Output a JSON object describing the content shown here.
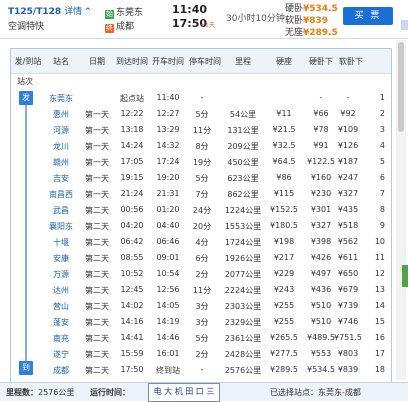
{
  "header": {
    "train_no": "T125/T128",
    "detail_label": "详情",
    "train_type": "空调特快",
    "from_tag": "始",
    "from_station": "东莞东",
    "to_tag": "终",
    "to_station": "成都",
    "depart_time": "11:40",
    "arrive_time": "17:50",
    "next_day": "+1天",
    "duration": "30小时10分钟",
    "prices": [
      {
        "label": "硬卧",
        "value": "¥534.5"
      },
      {
        "label": "软卧",
        "value": "¥839"
      },
      {
        "label": "无座",
        "value": "¥289.5"
      }
    ],
    "buy_label": "买 票"
  },
  "table": {
    "headers": [
      "发/到站",
      "站名",
      "日期",
      "到达时间",
      "开车时间",
      "停车时间",
      "里程",
      "硬座",
      "硬卧下",
      "软卧下"
    ],
    "subheader": "站次",
    "side_start": "发",
    "side_end": "到",
    "rows": [
      {
        "station": "东莞东",
        "day": "",
        "arr": "起点站",
        "dep": "11:40",
        "stop": "-",
        "dist": "",
        "hard": "",
        "hsl": "-",
        "ssl": "-",
        "idx": "1"
      },
      {
        "station": "惠州",
        "day": "第一天",
        "arr": "12:22",
        "dep": "12:27",
        "stop": "5分",
        "dist": "54公里",
        "hard": "¥11",
        "hsl": "¥66",
        "ssl": "¥92",
        "idx": "2"
      },
      {
        "station": "河源",
        "day": "第一天",
        "arr": "13:18",
        "dep": "13:29",
        "stop": "11分",
        "dist": "131公里",
        "hard": "¥21.5",
        "hsl": "¥78",
        "ssl": "¥109",
        "idx": "3"
      },
      {
        "station": "龙川",
        "day": "第一天",
        "arr": "14:24",
        "dep": "14:32",
        "stop": "8分",
        "dist": "209公里",
        "hard": "¥32.5",
        "hsl": "¥91",
        "ssl": "¥126",
        "idx": "4"
      },
      {
        "station": "赣州",
        "day": "第一天",
        "arr": "17:05",
        "dep": "17:24",
        "stop": "19分",
        "dist": "450公里",
        "hard": "¥64.5",
        "hsl": "¥122.5",
        "ssl": "¥187",
        "idx": "5"
      },
      {
        "station": "吉安",
        "day": "第一天",
        "arr": "19:15",
        "dep": "19:20",
        "stop": "5分",
        "dist": "623公里",
        "hard": "¥86",
        "hsl": "¥160",
        "ssl": "¥247",
        "idx": "6"
      },
      {
        "station": "南昌西",
        "day": "第一天",
        "arr": "21:24",
        "dep": "21:31",
        "stop": "7分",
        "dist": "862公里",
        "hard": "¥115",
        "hsl": "¥230",
        "ssl": "¥327",
        "idx": "7"
      },
      {
        "station": "武昌",
        "day": "第二天",
        "arr": "00:56",
        "dep": "01:20",
        "stop": "24分",
        "dist": "1224公里",
        "hard": "¥152.5",
        "hsl": "¥301",
        "ssl": "¥435",
        "idx": "8"
      },
      {
        "station": "襄阳东",
        "day": "第二天",
        "arr": "04:20",
        "dep": "04:40",
        "stop": "20分",
        "dist": "1553公里",
        "hard": "¥180.5",
        "hsl": "¥327",
        "ssl": "¥518",
        "idx": "9"
      },
      {
        "station": "十堰",
        "day": "第二天",
        "arr": "06:42",
        "dep": "06:46",
        "stop": "4分",
        "dist": "1724公里",
        "hard": "¥198",
        "hsl": "¥398",
        "ssl": "¥562",
        "idx": "10"
      },
      {
        "station": "安康",
        "day": "第二天",
        "arr": "08:55",
        "dep": "09:01",
        "stop": "6分",
        "dist": "1926公里",
        "hard": "¥217",
        "hsl": "¥426",
        "ssl": "¥611",
        "idx": "11"
      },
      {
        "station": "万源",
        "day": "第二天",
        "arr": "10:52",
        "dep": "10:54",
        "stop": "2分",
        "dist": "2077公里",
        "hard": "¥229",
        "hsl": "¥497",
        "ssl": "¥650",
        "idx": "12"
      },
      {
        "station": "达州",
        "day": "第二天",
        "arr": "12:45",
        "dep": "12:56",
        "stop": "11分",
        "dist": "2224公里",
        "hard": "¥243",
        "hsl": "¥436",
        "ssl": "¥679",
        "idx": "13"
      },
      {
        "station": "营山",
        "day": "第二天",
        "arr": "14:02",
        "dep": "14:05",
        "stop": "3分",
        "dist": "2303公里",
        "hard": "¥255",
        "hsl": "¥510",
        "ssl": "¥739",
        "idx": "14"
      },
      {
        "station": "蓬安",
        "day": "第二天",
        "arr": "14:16",
        "dep": "14:19",
        "stop": "3分",
        "dist": "2329公里",
        "hard": "¥255",
        "hsl": "¥510",
        "ssl": "¥746",
        "idx": "15"
      },
      {
        "station": "南充",
        "day": "第二天",
        "arr": "14:41",
        "dep": "14:46",
        "stop": "5分",
        "dist": "2361公里",
        "hard": "¥265.5",
        "hsl": "¥489.5",
        "ssl": "¥751.5",
        "idx": "16"
      },
      {
        "station": "遂宁",
        "day": "第二天",
        "arr": "15:59",
        "dep": "16:01",
        "stop": "2分",
        "dist": "2428公里",
        "hard": "¥277.5",
        "hsl": "¥553",
        "ssl": "¥803",
        "idx": "17"
      },
      {
        "station": "成都",
        "day": "第二天",
        "arr": "17:50",
        "dep": "终到站",
        "stop": "-",
        "dist": "2576公里",
        "hard": "¥289.5",
        "hsl": "¥534.5",
        "ssl": "¥839",
        "idx": "18"
      }
    ]
  },
  "footer": {
    "distance_label": "里程数：",
    "distance_value": "2576公里",
    "runtime_label": "运行时间：",
    "runtime_value": "30小时10分钟",
    "selected_label": "已选择站点：东莞东-成都",
    "watermark_text": "电 大 机 田 口 三"
  },
  "colors": {
    "accent": "#1a6fd6",
    "price": "#f07c12",
    "link": "#1a5fb4"
  }
}
